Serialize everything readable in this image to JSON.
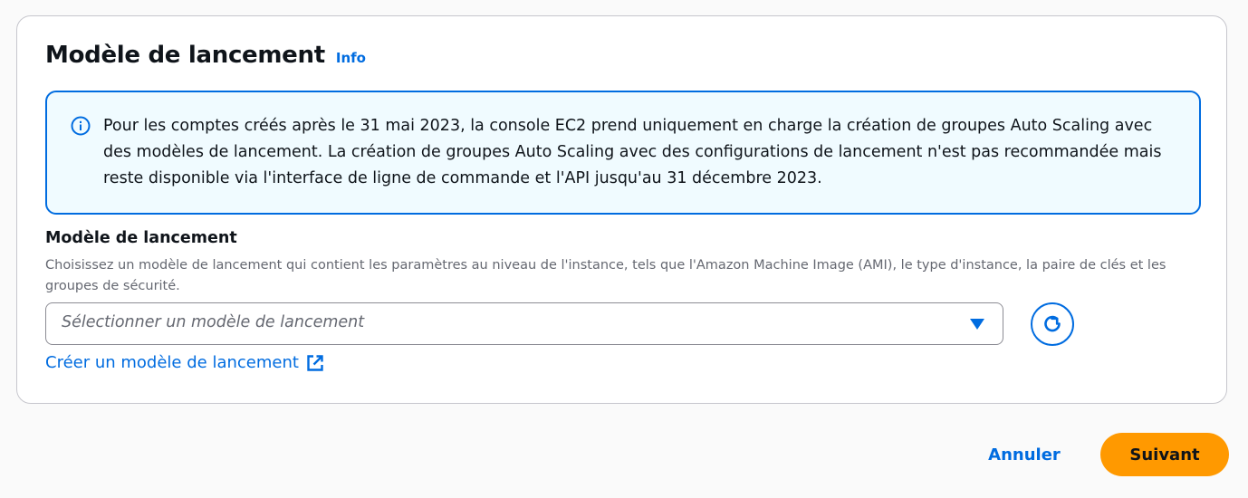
{
  "panel": {
    "title": "Modèle de lancement",
    "info_label": "Info"
  },
  "alert": {
    "icon": "info-circle-icon",
    "text": "Pour les comptes créés après le 31 mai 2023, la console EC2 prend uniquement en charge la création de groupes Auto Scaling avec des modèles de lancement. La création de groupes Auto Scaling avec des configurations de lancement n'est pas recommandée mais reste disponible via l'interface de ligne de commande et l'API jusqu'au 31 décembre 2023."
  },
  "field": {
    "label": "Modèle de lancement",
    "description": "Choisissez un modèle de lancement qui contient les paramètres au niveau de l'instance, tels que l'Amazon Machine Image (AMI), le type d'instance, la paire de clés et les groupes de sécurité.",
    "select_placeholder": "Sélectionner un modèle de lancement",
    "caret_icon": "caret-down-icon",
    "refresh_icon": "refresh-icon",
    "create_link_label": "Créer un modèle de lancement",
    "external_icon": "external-link-icon"
  },
  "footer": {
    "cancel_label": "Annuler",
    "next_label": "Suivant"
  },
  "colors": {
    "accent": "#006ce0",
    "alert_background": "#f0fbff",
    "primary_button": "#ff9900",
    "text": "#0f141a",
    "secondary_text": "#656871"
  }
}
